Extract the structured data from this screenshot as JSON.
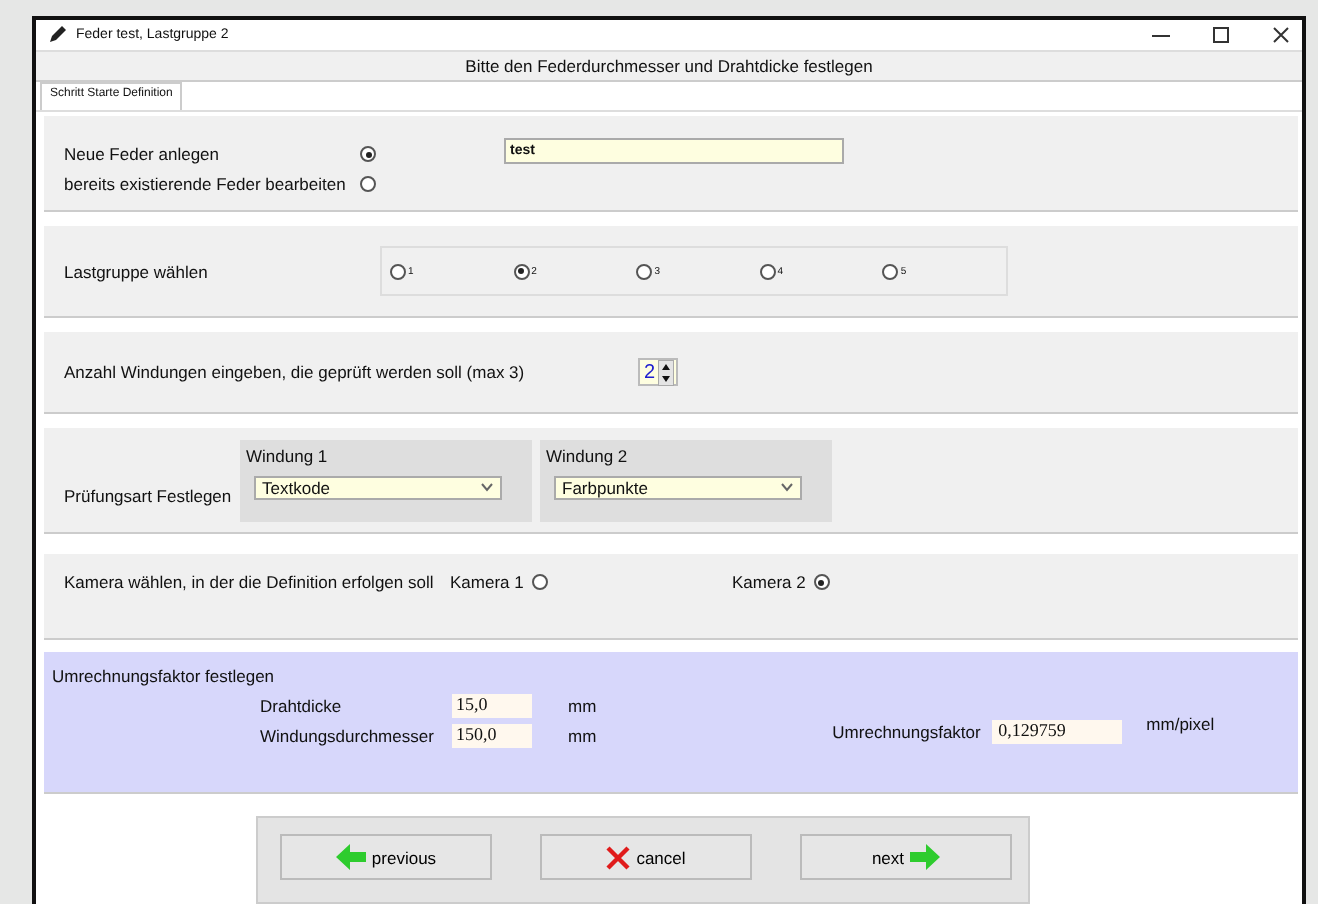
{
  "window": {
    "title": "Feder test,  Lastgruppe 2"
  },
  "header": "Bitte den Federdurchmesser und Drahtdicke festlegen",
  "tabs": [
    {
      "label": "Schritt Starte Definition",
      "selected": true
    }
  ],
  "spring": {
    "options": [
      {
        "label": "Neue Feder anlegen",
        "selected": true
      },
      {
        "label": "bereits existierende Feder bearbeiten",
        "selected": false
      }
    ],
    "name_value": "test"
  },
  "load_group": {
    "label": "Lastgruppe wählen",
    "options": [
      {
        "label": "1",
        "selected": false
      },
      {
        "label": "2",
        "selected": true
      },
      {
        "label": "3",
        "selected": false
      },
      {
        "label": "4",
        "selected": false
      },
      {
        "label": "5",
        "selected": false
      }
    ]
  },
  "windings": {
    "label": "Anzahl Windungen  eingeben, die geprüft werden soll (max 3)",
    "value": "2"
  },
  "test_type": {
    "label": "Prüfungsart Festlegen",
    "windings": [
      {
        "title": "Windung 1",
        "value": "Textkode"
      },
      {
        "title": "Windung 2",
        "value": "Farbpunkte"
      }
    ]
  },
  "camera": {
    "label": "Kamera wählen, in der die Definition erfolgen soll",
    "options": [
      {
        "label": "Kamera 1",
        "selected": false
      },
      {
        "label": "Kamera 2",
        "selected": true
      }
    ]
  },
  "conversion": {
    "title": "Umrechnungsfaktor festlegen",
    "fields": [
      {
        "label": "Drahtdicke",
        "value": "15,0",
        "unit": "mm"
      },
      {
        "label": "Windungsdurchmesser",
        "value": "150,0",
        "unit": "mm"
      }
    ],
    "factor": {
      "label": "Umrechnungsfaktor",
      "value": "0,129759",
      "unit": "mm/pixel"
    }
  },
  "buttons": [
    {
      "label": "previous",
      "kind": "previous"
    },
    {
      "label": "cancel",
      "kind": "cancel"
    },
    {
      "label": "next",
      "kind": "next"
    }
  ]
}
